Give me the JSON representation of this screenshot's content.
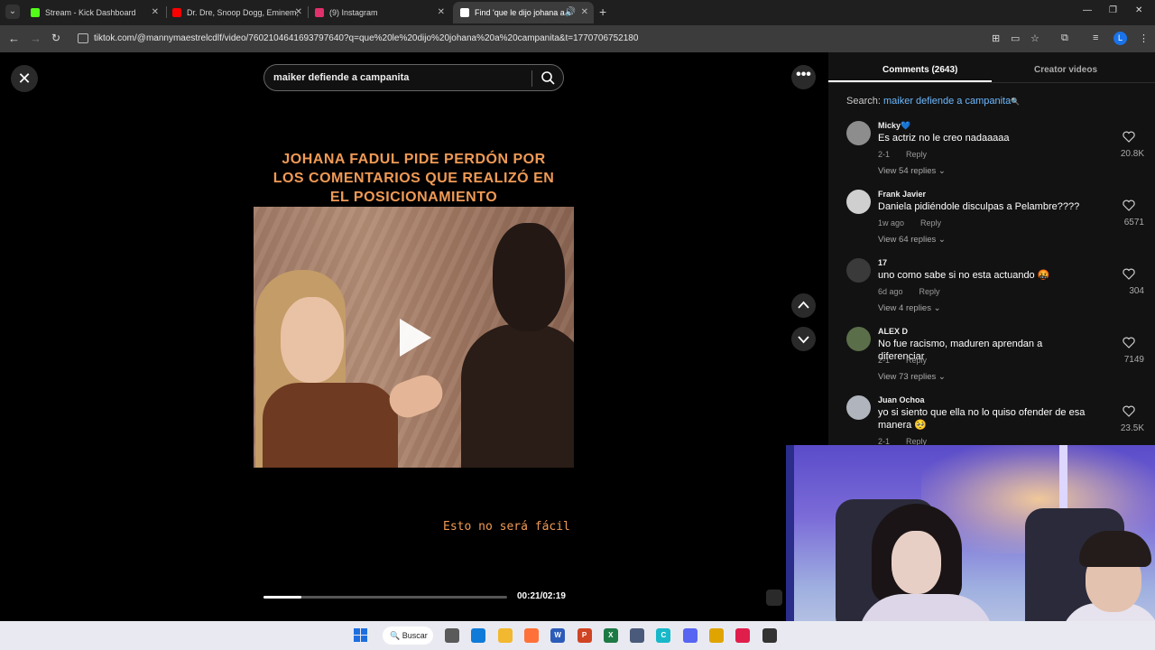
{
  "browser": {
    "tabs": [
      {
        "label": "Stream - Kick Dashboard",
        "icon": "kick-icon",
        "color": "#53fc18"
      },
      {
        "label": "Dr. Dre, Snoop Dogg, Eminem,",
        "icon": "youtube-icon",
        "color": "#ff0000"
      },
      {
        "label": "(9) Instagram",
        "icon": "instagram-icon",
        "color": "#e1306c"
      },
      {
        "label": "Find 'que le dijo johana a c",
        "icon": "tiktok-icon",
        "color": "#ffffff"
      }
    ],
    "new_tab": "+",
    "url": "tiktok.com/@mannymaestrelcdlf/video/7602104641693797640?q=que%20le%20dijo%20johana%20a%20campanita&t=1770706752180",
    "profile_initial": "L"
  },
  "video": {
    "search_query": "maiker defiende a campanita",
    "headline": [
      "Johana Fadul pide perdón por",
      "los comentarios que realizó en",
      "el posicionamiento"
    ],
    "subtitle": "Esto no será fácil",
    "time": "00:21/02:19",
    "progress": 0.155
  },
  "comments_panel": {
    "tabs": {
      "comments": "Comments (2643)",
      "creator_videos": "Creator videos"
    },
    "search_label": "Search:",
    "search_query": "maiker defiende a campanita",
    "reply_label": "Reply",
    "comments": [
      {
        "user": "Micky💙",
        "text": "Es actriz no le creo nadaaaaa",
        "date": "2-1",
        "likes": "20.8K",
        "view_replies": "View 54 replies",
        "avatar_color": "#8d8d8d"
      },
      {
        "user": "Frank Javier",
        "text": "Daniela pidiéndole disculpas a Pelambre????",
        "date": "1w ago",
        "likes": "6571",
        "view_replies": "View 64 replies",
        "avatar_color": "#cfcfcf"
      },
      {
        "user": "17",
        "text": "uno como sabe si no esta actuando 🤬",
        "date": "6d ago",
        "likes": "304",
        "view_replies": "View 4 replies",
        "avatar_color": "#3a3a3a"
      },
      {
        "user": "ALEX D",
        "text": "No fue racismo, maduren aprendan a diferenciar",
        "date": "2-1",
        "likes": "7149",
        "view_replies": "View 73 replies",
        "avatar_color": "#5a6e4a"
      },
      {
        "user": "Juan Ochoa",
        "text": "yo si siento que ella no lo quiso ofender de esa manera 🥺",
        "date": "2-1",
        "likes": "23.5K",
        "view_replies": "",
        "avatar_color": "#b0b4bd"
      }
    ]
  },
  "taskbar": {
    "search_label": "Buscar",
    "apps": [
      {
        "name": "task-view-icon",
        "color": "#5a5a5a",
        "glyph": ""
      },
      {
        "name": "edge-icon",
        "color": "#0f7bd8",
        "glyph": ""
      },
      {
        "name": "file-explorer-icon",
        "color": "#f2b82f",
        "glyph": ""
      },
      {
        "name": "firefox-icon",
        "color": "#ff7139",
        "glyph": ""
      },
      {
        "name": "word-icon",
        "color": "#2b5cb8",
        "glyph": "W"
      },
      {
        "name": "powerpoint-icon",
        "color": "#d04423",
        "glyph": "P"
      },
      {
        "name": "excel-icon",
        "color": "#1d7a45",
        "glyph": "X"
      },
      {
        "name": "app-icon",
        "color": "#4a5a7a",
        "glyph": ""
      },
      {
        "name": "canva-icon",
        "color": "#18b8c9",
        "glyph": "C"
      },
      {
        "name": "discord-icon",
        "color": "#5865f2",
        "glyph": ""
      },
      {
        "name": "chrome-icon",
        "color": "#e0a400",
        "glyph": ""
      },
      {
        "name": "tiktok-icon",
        "color": "#e01e4c",
        "glyph": ""
      },
      {
        "name": "obs-icon",
        "color": "#333333",
        "glyph": ""
      }
    ]
  }
}
